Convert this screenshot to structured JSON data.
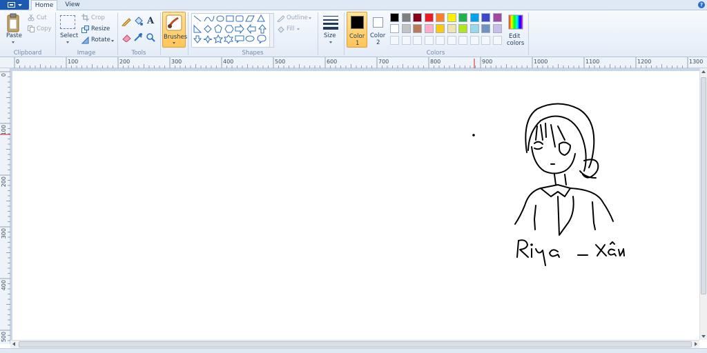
{
  "tabs": {
    "home": "Home",
    "view": "View"
  },
  "help_icon": "?",
  "clipboard": {
    "paste": "Paste",
    "cut": "Cut",
    "copy": "Copy",
    "group": "Clipboard"
  },
  "image": {
    "select": "Select",
    "crop": "Crop",
    "resize": "Resize",
    "rotate": "Rotate",
    "group": "Image"
  },
  "tools": {
    "group": "Tools",
    "text_glyph": "A"
  },
  "brushes": {
    "label": "Brushes"
  },
  "shapes": {
    "outline": "Outline",
    "fill": "Fill",
    "group": "Shapes"
  },
  "size": {
    "label": "Size"
  },
  "colors": {
    "color1": "Color",
    "color1_num": "1",
    "color2": "Color",
    "color2_num": "2",
    "edit": "Edit",
    "edit2": "colors",
    "group": "Colors",
    "row1": [
      "#000000",
      "#7f7f7f",
      "#880015",
      "#ed1c24",
      "#ff7f27",
      "#fff200",
      "#22b14c",
      "#00a2e8",
      "#3f48cc",
      "#a349a4"
    ],
    "row2": [
      "#ffffff",
      "#c3c3c3",
      "#b97a57",
      "#ffaec9",
      "#ffc90e",
      "#efe4b0",
      "#b5e61d",
      "#99d9ea",
      "#7092be",
      "#c8bfe7"
    ],
    "color1_value": "#000000",
    "color2_value": "#ffffff"
  },
  "ruler": {
    "h_labels": [
      "0",
      "100",
      "200",
      "300",
      "400",
      "500",
      "600",
      "700",
      "800",
      "900",
      "1000",
      "1100",
      "1200",
      "1300"
    ],
    "v_labels": [
      "0",
      "100",
      "200",
      "300",
      "400",
      "500"
    ]
  },
  "drawing": {
    "signature_text": "Riya - Xấu"
  }
}
